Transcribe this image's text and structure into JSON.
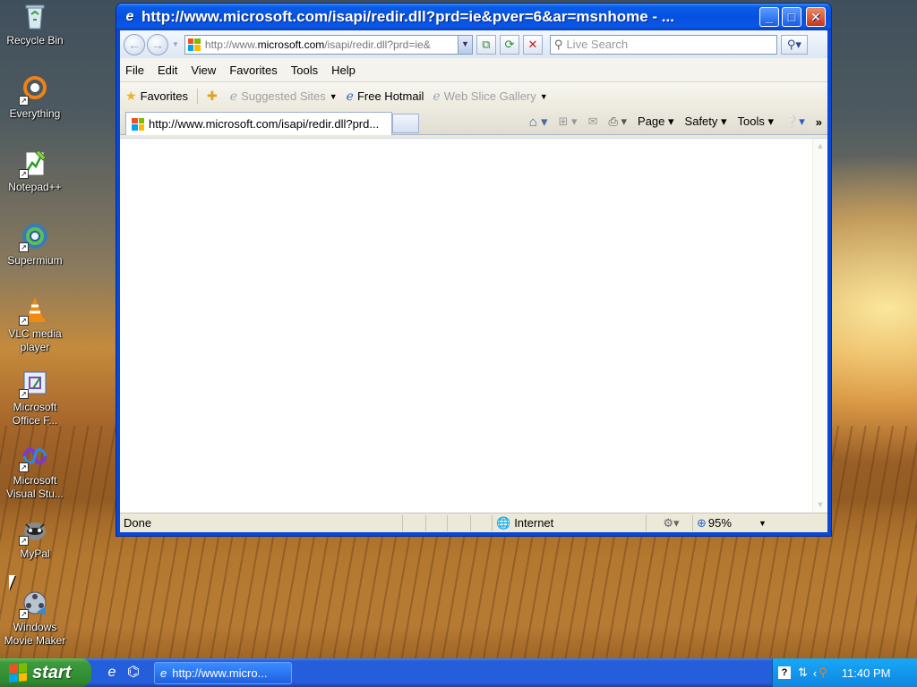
{
  "desktop": {
    "icons": [
      {
        "label": "Recycle Bin",
        "icon": "recycle-bin-icon"
      },
      {
        "label": "Everything",
        "icon": "everything-search-icon"
      },
      {
        "label": "Notepad++",
        "icon": "notepad-plus-plus-icon"
      },
      {
        "label": "Supermium",
        "icon": "supermium-browser-icon"
      },
      {
        "label": "VLC media player",
        "icon": "vlc-cone-icon"
      },
      {
        "label": "Microsoft Office F...",
        "icon": "office-frontpage-icon"
      },
      {
        "label": "Microsoft Visual Stu...",
        "icon": "visual-studio-icon"
      },
      {
        "label": "MyPal",
        "icon": "mypal-browser-icon"
      },
      {
        "label": "Windows Movie Maker",
        "icon": "movie-maker-icon"
      }
    ]
  },
  "browser": {
    "window_title": "http://www.microsoft.com/isapi/redir.dll?prd=ie&pver=6&ar=msnhome - ...",
    "address": {
      "prefix": "http://www.",
      "domain": "microsoft.com",
      "suffix": "/isapi/redir.dll?prd=ie&"
    },
    "search_placeholder": "Live Search",
    "menu": [
      "File",
      "Edit",
      "View",
      "Favorites",
      "Tools",
      "Help"
    ],
    "favorites_bar": {
      "favorites_label": "Favorites",
      "items": [
        {
          "label": "Suggested Sites",
          "enabled": false
        },
        {
          "label": "Free Hotmail",
          "enabled": true
        },
        {
          "label": "Web Slice Gallery",
          "enabled": false
        }
      ]
    },
    "tab": {
      "title": "http://www.microsoft.com/isapi/redir.dll?prd..."
    },
    "command_bar": {
      "page": "Page",
      "safety": "Safety",
      "tools": "Tools"
    },
    "status": {
      "text": "Done",
      "zone": "Internet",
      "zoom": "95%"
    }
  },
  "taskbar": {
    "start_label": "start",
    "task_button": "http://www.micro...",
    "clock": "11:40 PM"
  },
  "colors": {
    "ms_red": "#f25022",
    "ms_green": "#7fba00",
    "ms_blue": "#00a4ef",
    "ms_yellow": "#ffb900"
  }
}
